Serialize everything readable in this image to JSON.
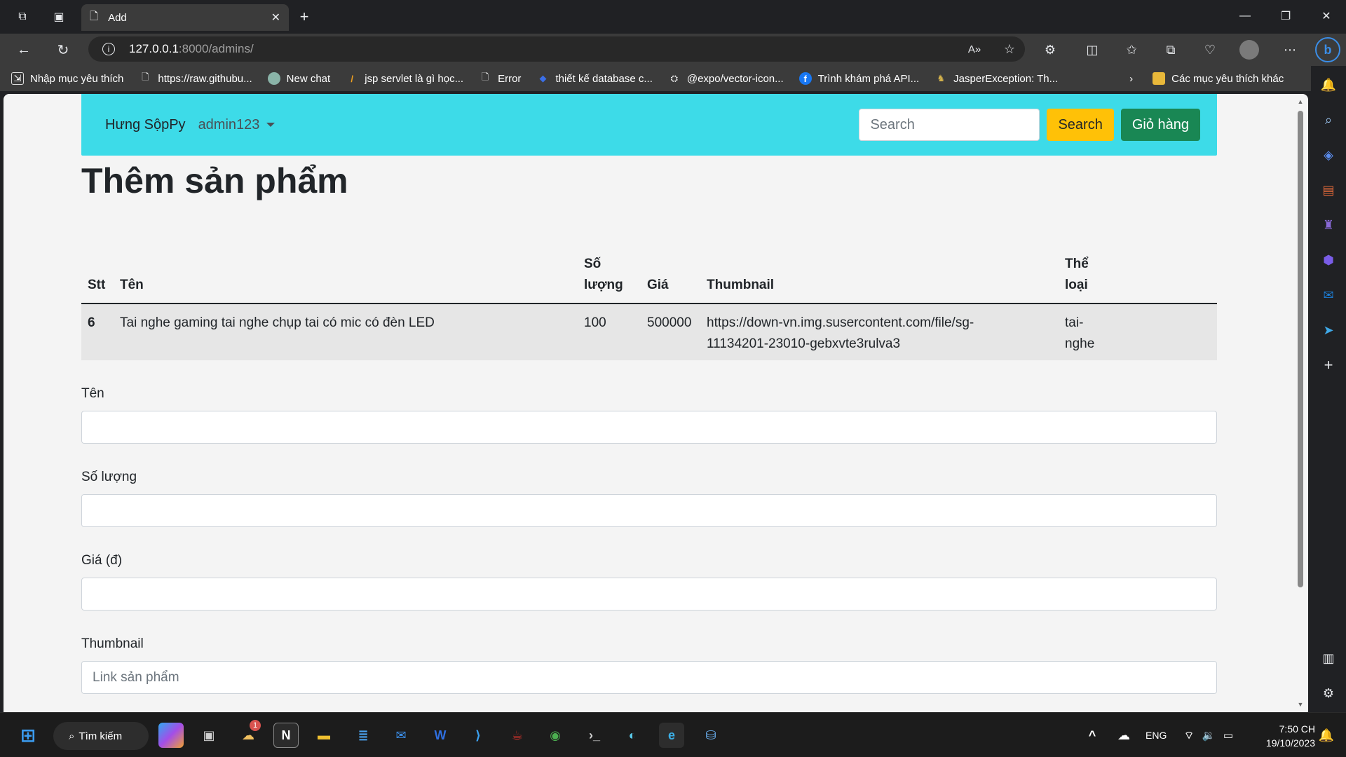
{
  "browser": {
    "tab_title": "Add",
    "url_host": "127.0.0.1",
    "url_path": ":8000/admins/",
    "bookmarks": [
      {
        "label": "Nhập mục yêu thích"
      },
      {
        "label": "https://raw.githubu..."
      },
      {
        "label": "New chat"
      },
      {
        "label": "jsp servlet là gì học..."
      },
      {
        "label": "Error"
      },
      {
        "label": "thiết kế database c..."
      },
      {
        "label": "@expo/vector-icon..."
      },
      {
        "label": "Trình khám phá API..."
      },
      {
        "label": "JasperException: Th..."
      }
    ],
    "other_favorites": "Các mục yêu thích khác"
  },
  "navbar": {
    "brand": "Hưng SộpPy",
    "user": "admin123",
    "search_placeholder": "Search",
    "search_button": "Search",
    "cart_button": "Giỏ hàng"
  },
  "page": {
    "title": "Thêm sản phẩm"
  },
  "table": {
    "headers": {
      "stt": "Stt",
      "ten": "Tên",
      "so_luong_1": "Số",
      "so_luong_2": "lượng",
      "gia": "Giá",
      "thumbnail": "Thumbnail",
      "the_loai_1": "Thể",
      "the_loai_2": "loại"
    },
    "rows": [
      {
        "stt": "6",
        "ten": "Tai nghe gaming tai nghe chụp tai có mic có đèn LED",
        "so_luong": "100",
        "gia": "500000",
        "thumbnail_1": "https://down-vn.img.susercontent.com/file/sg-",
        "thumbnail_2": "11134201-23010-gebxvte3rulva3",
        "the_loai_1": "tai-",
        "the_loai_2": "nghe"
      }
    ]
  },
  "form": {
    "ten_label": "Tên",
    "so_luong_label": "Số lượng",
    "gia_label": "Giá (đ)",
    "thumbnail_label": "Thumbnail",
    "thumbnail_placeholder": "Link sản phẩm"
  },
  "taskbar": {
    "search_label": "Tìm kiếm",
    "notification_count": "1",
    "language": "ENG",
    "time": "7:50 CH",
    "date": "19/10/2023"
  },
  "colors": {
    "navbar_bg": "#3ddbe8",
    "search_button": "#ffc107",
    "cart_button": "#198754"
  }
}
